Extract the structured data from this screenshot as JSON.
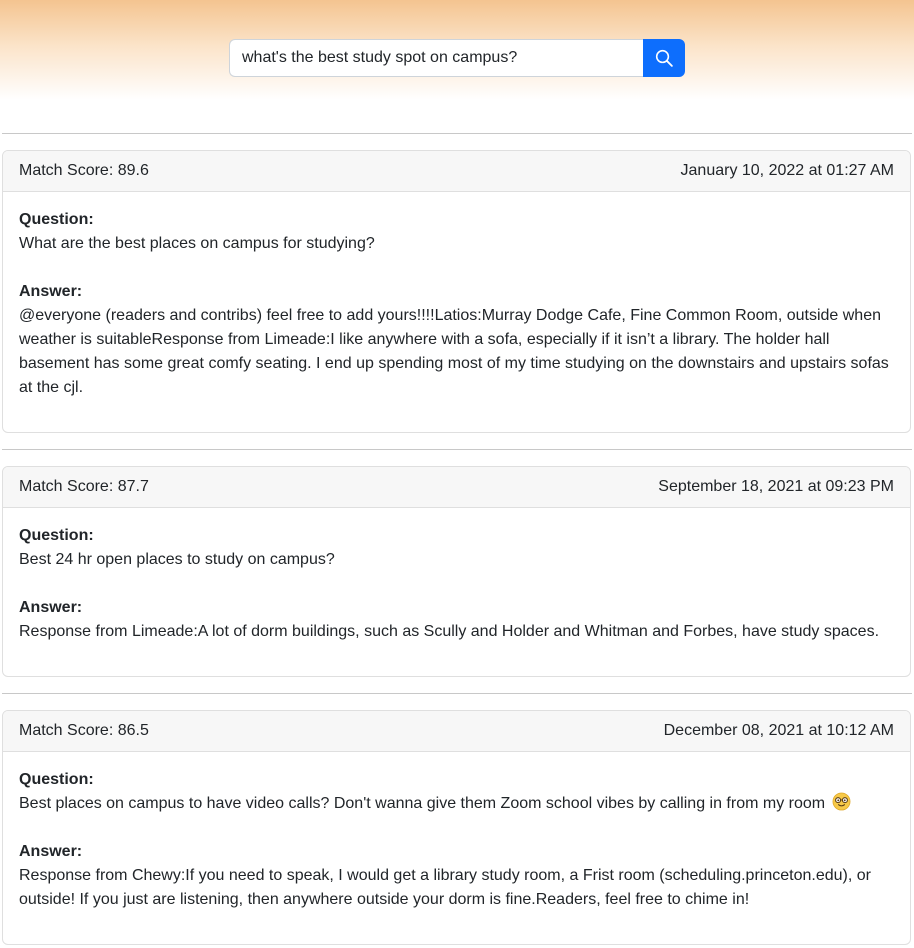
{
  "search": {
    "query": "what's the best study spot on campus?"
  },
  "results": [
    {
      "match_score": "Match Score: 89.6",
      "date": "January 10, 2022 at 01:27 AM",
      "question_label": "Question:",
      "question": "What are the best places on campus for studying?",
      "answer_label": "Answer:",
      "answer": "@everyone (readers and contribs) feel free to add yours!!!!Latios:Murray Dodge Cafe, Fine Common Room, outside when weather is suitableResponse from Limeade:I like anywhere with a sofa, especially if it isn’t a library. The holder hall basement has some great comfy seating. I end up spending most of my time studying on the downstairs and upstairs sofas at the cjl."
    },
    {
      "match_score": "Match Score: 87.7",
      "date": "September 18, 2021 at 09:23 PM",
      "question_label": "Question:",
      "question": "Best 24 hr open places to study on campus?",
      "answer_label": "Answer:",
      "answer": "Response from Limeade:A lot of dorm buildings, such as Scully and Holder and Whitman and Forbes, have study spaces."
    },
    {
      "match_score": "Match Score: 86.5",
      "date": "December 08, 2021 at 10:12 AM",
      "question_label": "Question:",
      "question": "Best places on campus to have video calls? Don't wanna give them Zoom school vibes by calling in from my room",
      "question_emoji": "nerd-face-emoji",
      "answer_label": "Answer:",
      "answer": "Response from Chewy:If you need to speak, I would get a library study room, a Frist room (scheduling.princeton.edu), or outside! If you just are listening, then anywhere outside your dorm is fine.Readers, feel free to chime in!"
    }
  ],
  "colors": {
    "accent": "#0d6efd",
    "header_gradient_top": "#f4c490",
    "card_header_bg": "#f7f7f7"
  }
}
